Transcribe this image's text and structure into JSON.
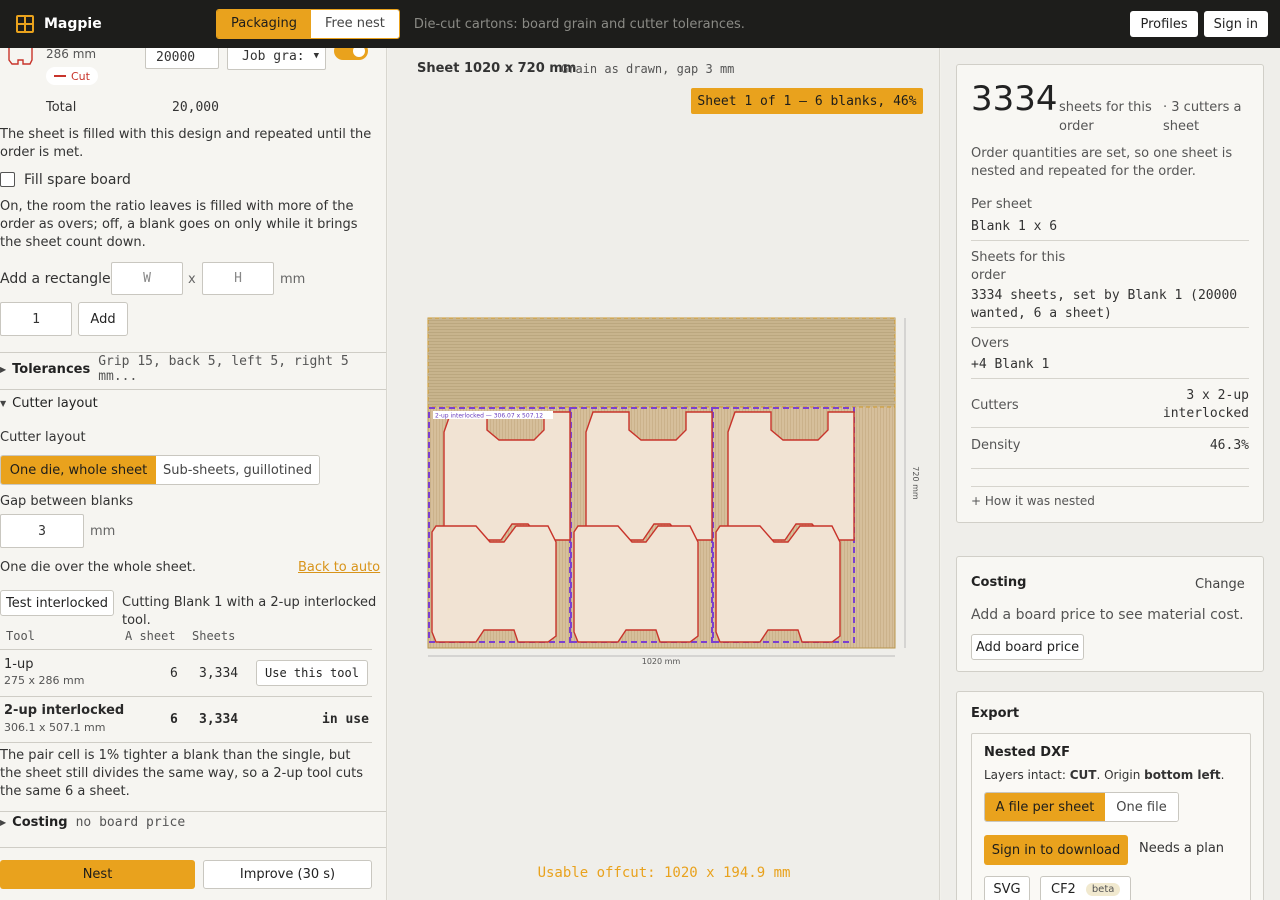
{
  "topbar": {
    "brand": "Magpie",
    "modes": [
      "Packaging",
      "Free nest"
    ],
    "tagline": "Die-cut cartons: board grain and cutter tolerances.",
    "profiles": "Profiles",
    "sign_in": "Sign in"
  },
  "left": {
    "job": {
      "size": "286 mm",
      "cut_badge": "Cut",
      "qty": "20000",
      "grain_select": "Job gra:",
      "total_label": "Total",
      "total_value": "20,000"
    },
    "fill_note": "The sheet is filled with this design and repeated until the order is met.",
    "fill_spare_label": "Fill spare board",
    "fill_spare_note": "On, the room the ratio leaves is filled with more of the order as overs; off, a blank goes on only while it brings the sheet count down.",
    "add_rect": {
      "label": "Add a rectangle",
      "w_placeholder": "W",
      "x": "x",
      "h_placeholder": "H",
      "unit": "mm",
      "count": "1",
      "add_btn": "Add"
    },
    "tolerances": {
      "title": "Tolerances",
      "summary": "Grip 15, back 5, left 5, right 5 mm..."
    },
    "cutter": {
      "title": "Cutter layout",
      "field_label": "Cutter layout",
      "options": [
        "One die, whole sheet",
        "Sub-sheets, guillotined"
      ],
      "gap_label": "Gap between blanks",
      "gap_value": "3",
      "gap_unit": "mm",
      "die_note": "One die over the whole sheet.",
      "back_to_auto": "Back to auto",
      "test_btn": "Test interlocked",
      "test_note": "Cutting Blank 1 with a 2-up interlocked tool.",
      "table": {
        "headers": [
          "Tool",
          "A sheet",
          "Sheets"
        ],
        "rows": [
          {
            "tool": "1-up",
            "dims": "275 x 286 mm",
            "a_sheet": "6",
            "sheets": "3,334",
            "action": "Use this tool"
          },
          {
            "tool": "2-up interlocked",
            "dims": "306.1 x 507.1 mm",
            "a_sheet": "6",
            "sheets": "3,334",
            "action": "in use"
          }
        ]
      },
      "pair_note": "The pair cell is 1% tighter a blank than the single, but the sheet still divides the same way, so a 2-up tool cuts the same 6 a sheet."
    },
    "costing": {
      "title": "Costing",
      "summary": "no board price"
    },
    "nest_btn": "Nest",
    "improve_btn": "Improve (30 s)"
  },
  "center": {
    "sheet_title": "Sheet 1020 x 720 mm",
    "grain_note": "Grain as drawn, gap 3 mm",
    "sheet_badge": "Sheet 1 of 1 — 6 blanks, 46%",
    "width_label": "1020 mm",
    "height_label": "720 mm",
    "tool_tag": "2-up interlocked — 306.07 x 507.12",
    "offcut": "Usable offcut: 1020 x 194.9 mm"
  },
  "summary": {
    "big_number": "3334",
    "big_label": "sheets for this order",
    "cutters_note": "· 3 cutters a sheet",
    "order_note": "Order quantities are set, so one sheet is nested and repeated for the order.",
    "per_sheet_label": "Per sheet",
    "per_sheet_value": "Blank 1 x 6",
    "sheets_label": "Sheets for this order",
    "sheets_value": "3334 sheets, set by Blank 1 (20000 wanted, 6 a sheet)",
    "overs_label": "Overs",
    "overs_value": "+4 Blank 1",
    "cutters_label": "Cutters",
    "cutters_value": "3 x 2-up interlocked",
    "density_label": "Density",
    "density_value": "46.3%",
    "how_nested": "+ How it was nested"
  },
  "costing_card": {
    "title": "Costing",
    "change": "Change",
    "note": "Add a board price to see material cost.",
    "add_btn": "Add board price"
  },
  "export": {
    "title": "Export",
    "dxf_title": "Nested DXF",
    "layers_prefix": "Layers intact: ",
    "layers_cut": "CUT",
    "origin_prefix": ". Origin ",
    "origin_value": "bottom left",
    "origin_suffix": ".",
    "file_options": [
      "A file per sheet",
      "One file"
    ],
    "sign_in_btn": "Sign in to download",
    "needs_plan": "Needs a plan",
    "svg_btn": "SVG",
    "cf2_btn": "CF2",
    "beta": "beta"
  },
  "colors": {
    "accent": "#e9a21d",
    "cut_red": "#c8342b",
    "tool_purple": "#7b3fd0",
    "board": "#d6bf9b"
  }
}
